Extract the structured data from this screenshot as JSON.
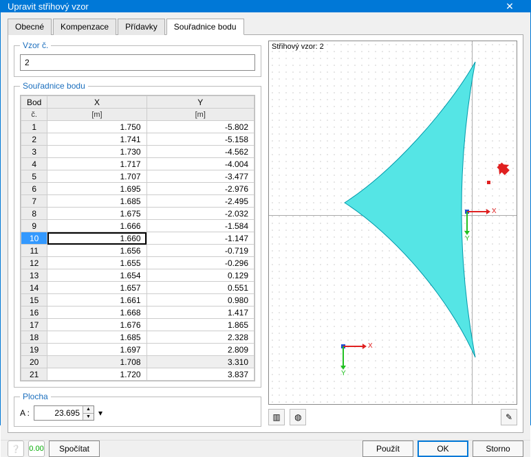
{
  "window": {
    "title": "Upravit střihový vzor"
  },
  "tabs": [
    "Obecné",
    "Kompenzace",
    "Přídavky",
    "Souřadnice bodu"
  ],
  "active_tab": 3,
  "vzor": {
    "legend": "Vzor č.",
    "value": "2"
  },
  "coords": {
    "legend": "Souřadnice bodu",
    "head": {
      "col0a": "Bod",
      "col0b": "č.",
      "col1a": "X",
      "col1b": "[m]",
      "col2a": "Y",
      "col2b": "[m]"
    },
    "selected_row": 10,
    "rows": [
      {
        "n": 1,
        "x": "1.750",
        "y": "-5.802"
      },
      {
        "n": 2,
        "x": "1.741",
        "y": "-5.158"
      },
      {
        "n": 3,
        "x": "1.730",
        "y": "-4.562"
      },
      {
        "n": 4,
        "x": "1.717",
        "y": "-4.004"
      },
      {
        "n": 5,
        "x": "1.707",
        "y": "-3.477"
      },
      {
        "n": 6,
        "x": "1.695",
        "y": "-2.976"
      },
      {
        "n": 7,
        "x": "1.685",
        "y": "-2.495"
      },
      {
        "n": 8,
        "x": "1.675",
        "y": "-2.032"
      },
      {
        "n": 9,
        "x": "1.666",
        "y": "-1.584"
      },
      {
        "n": 10,
        "x": "1.660",
        "y": "-1.147"
      },
      {
        "n": 11,
        "x": "1.656",
        "y": "-0.719"
      },
      {
        "n": 12,
        "x": "1.655",
        "y": "-0.296"
      },
      {
        "n": 13,
        "x": "1.654",
        "y": "0.129"
      },
      {
        "n": 14,
        "x": "1.657",
        "y": "0.551"
      },
      {
        "n": 15,
        "x": "1.661",
        "y": "0.980"
      },
      {
        "n": 16,
        "x": "1.668",
        "y": "1.417"
      },
      {
        "n": 17,
        "x": "1.676",
        "y": "1.865"
      },
      {
        "n": 18,
        "x": "1.685",
        "y": "2.328"
      },
      {
        "n": 19,
        "x": "1.697",
        "y": "2.809"
      },
      {
        "n": 20,
        "x": "1.708",
        "y": "3.310"
      },
      {
        "n": 21,
        "x": "1.720",
        "y": "3.837"
      }
    ]
  },
  "plocha": {
    "legend": "Plocha",
    "label": "A :",
    "value": "23.695",
    "unit": "▾"
  },
  "canvas": {
    "label": "Střihový vzor: 2",
    "axis_x": "X",
    "axis_y": "Y"
  },
  "footer": {
    "compute": "Spočítat",
    "apply": "Použít",
    "ok": "OK",
    "cancel": "Storno"
  }
}
